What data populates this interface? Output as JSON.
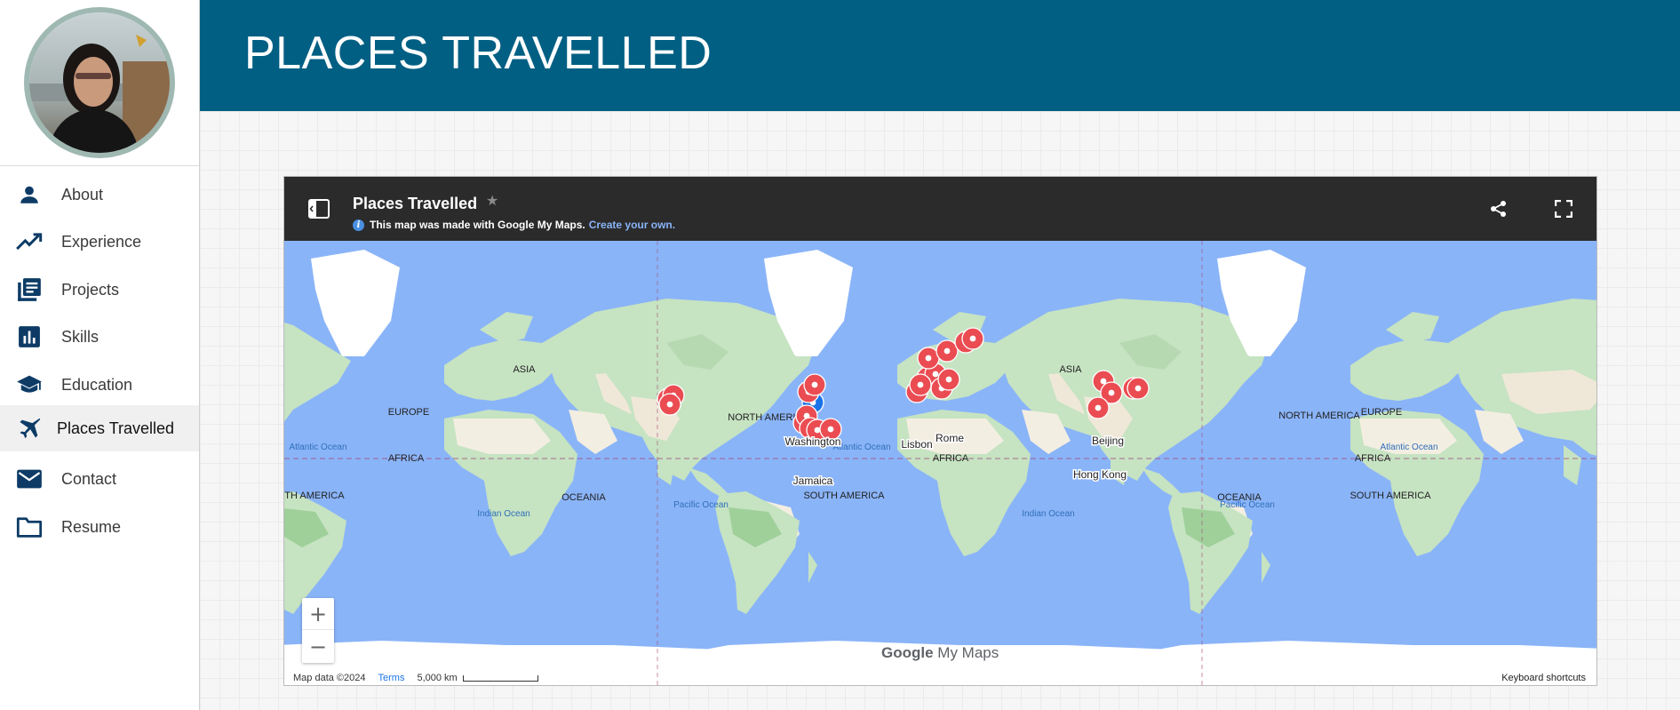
{
  "header": {
    "title": "PLACES TRAVELLED"
  },
  "sidebar": {
    "items": [
      {
        "label": "About",
        "icon": "person-icon"
      },
      {
        "label": "Experience",
        "icon": "trending-up-icon"
      },
      {
        "label": "Projects",
        "icon": "articles-icon"
      },
      {
        "label": "Skills",
        "icon": "bar-chart-icon"
      },
      {
        "label": "Education",
        "icon": "graduation-cap-icon"
      },
      {
        "label": "Places Travelled",
        "icon": "airplane-icon",
        "active": true
      },
      {
        "label": "Contact",
        "icon": "mail-icon"
      },
      {
        "label": "Resume",
        "icon": "folder-icon"
      }
    ]
  },
  "map": {
    "title": "Places Travelled",
    "notice": "This map was made with Google My Maps.",
    "notice_link": "Create your own.",
    "attribution": "Map data ©2024",
    "terms": "Terms",
    "scale": "5,000 km",
    "keyboard_shortcuts": "Keyboard shortcuts",
    "logo_google": "Google",
    "logo_mymaps": "My Maps",
    "zoom_in": "+",
    "zoom_out": "−",
    "labels": {
      "asia": "ASIA",
      "europe": "EUROPE",
      "africa": "AFRICA",
      "north_america": "NORTH AMERICA",
      "south_america": "SOUTH AMERICA",
      "oceania": "OCEANIA",
      "atlantic_ocean": "Atlantic Ocean",
      "indian_ocean": "Indian Ocean",
      "pacific_ocean": "Pacific Ocean",
      "washington": "Washington",
      "jamaica": "Jamaica",
      "lisbon": "Lisbon",
      "rome": "Rome",
      "beijing": "Beijing",
      "hong_kong": "Hong Kong"
    },
    "colors": {
      "ocean": "#8ab4f8",
      "land": "#c6e3c2",
      "desert": "#f3eee2",
      "ice": "#ffffff",
      "marker": "#ea4c52",
      "marker_highlight": "#1a73e8"
    }
  }
}
